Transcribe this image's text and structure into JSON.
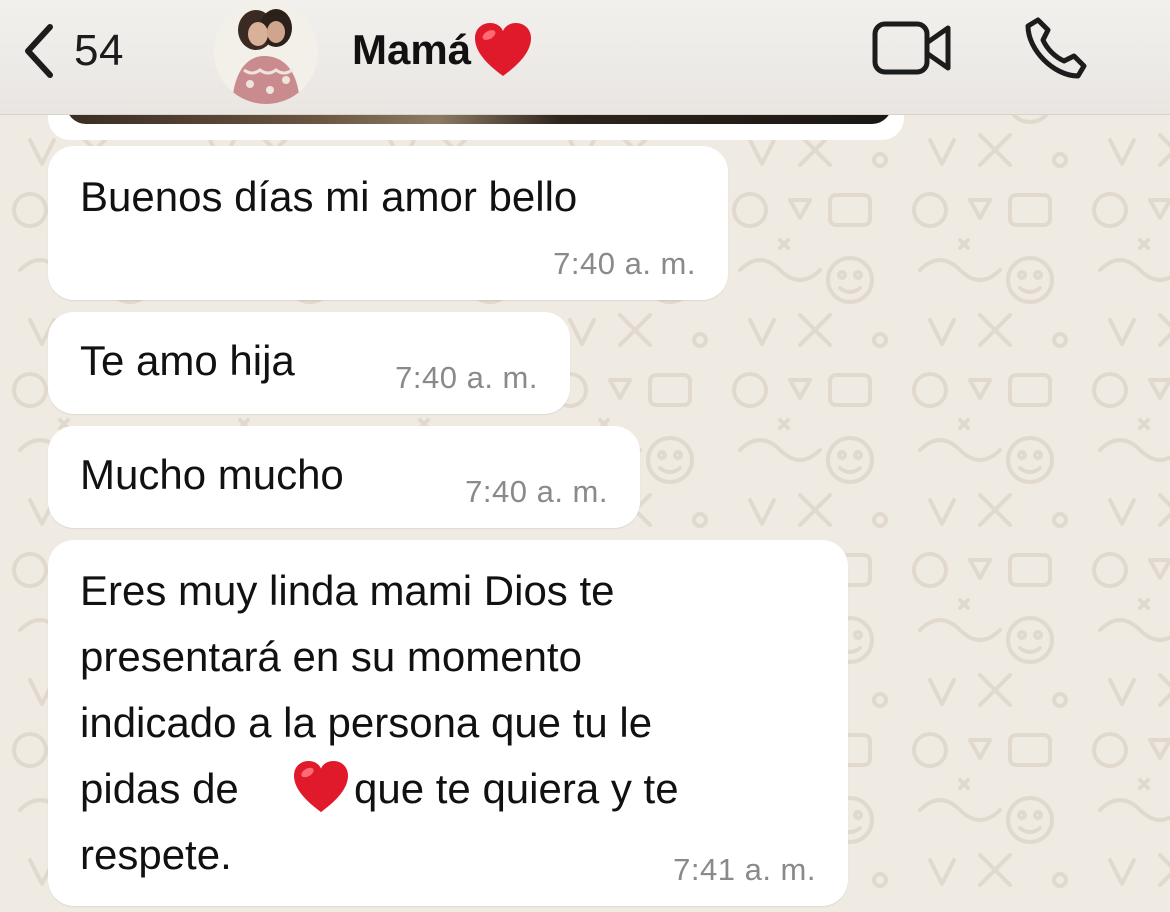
{
  "header": {
    "back_count": "54",
    "contact_name": "Mamá"
  },
  "messages": [
    {
      "text": "Buenos días mi amor bello",
      "time": "7:40 a. m."
    },
    {
      "text": "Te amo hija",
      "time": "7:40 a. m."
    },
    {
      "text": "Mucho mucho",
      "time": "7:40 a. m."
    },
    {
      "lines": [
        "Eres muy linda mami Dios te",
        "presentará en su momento",
        "indicado a la persona que tu le",
        "pidas de",
        "que te quiera y te",
        "respete."
      ],
      "time": "7:41 a. m."
    }
  ],
  "colors": {
    "wallpaper": "#efeae2",
    "bubble": "#ffffff",
    "timestamp": "#8a8a8a",
    "heart": "#e0192b"
  },
  "icons": [
    "chevron-left-icon",
    "video-camera-icon",
    "phone-icon",
    "red-heart-emoji"
  ]
}
